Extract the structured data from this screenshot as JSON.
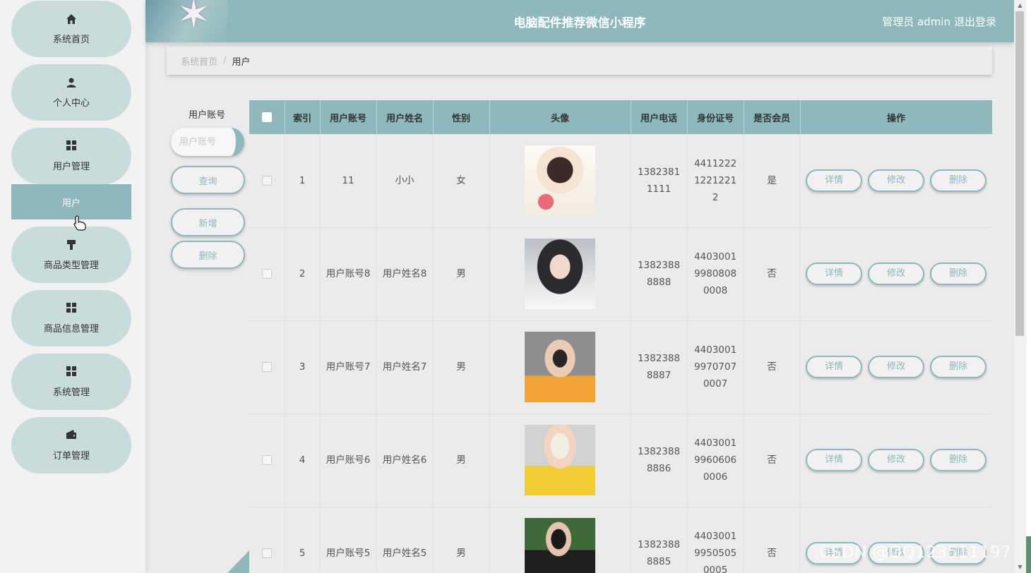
{
  "sidebar": {
    "items": [
      {
        "label": "系统首页",
        "icon": "home-icon",
        "glyph": "⌂"
      },
      {
        "label": "个人中心",
        "icon": "person-icon",
        "glyph": "👤"
      },
      {
        "label": "用户管理",
        "icon": "grid-icon",
        "glyph": "▦"
      },
      {
        "label": "商品类型管理",
        "icon": "brush-icon",
        "glyph": "▀"
      },
      {
        "label": "商品信息管理",
        "icon": "grid-icon",
        "glyph": "▦"
      },
      {
        "label": "系统管理",
        "icon": "grid-icon",
        "glyph": "▦"
      },
      {
        "label": "订单管理",
        "icon": "wallet-icon",
        "glyph": "▬"
      }
    ],
    "active_sub": "用户"
  },
  "header": {
    "title": "电脑配件推荐微信小程序",
    "user": "管理员 admin",
    "logout": "退出登录"
  },
  "breadcrumb": {
    "home": "系统首页",
    "separator": "/",
    "current": "用户"
  },
  "search": {
    "label": "用户账号",
    "placeholder": "用户账号",
    "query_button": "查询",
    "add_button": "新增",
    "delete_button": "删除"
  },
  "table": {
    "columns": [
      "索引",
      "用户账号",
      "用户姓名",
      "性别",
      "头像",
      "用户电话",
      "身份证号",
      "是否会员",
      "操作"
    ],
    "rows": [
      {
        "index": "1",
        "account": "11",
        "name": "小小",
        "gender": "女",
        "phone": "13823811111",
        "id_no": "441122212212212",
        "member": "是"
      },
      {
        "index": "2",
        "account": "用户账号8",
        "name": "用户姓名8",
        "gender": "男",
        "phone": "13823888888",
        "id_no": "440300199808080008",
        "member": "否"
      },
      {
        "index": "3",
        "account": "用户账号7",
        "name": "用户姓名7",
        "gender": "男",
        "phone": "13823888887",
        "id_no": "440300199707070007",
        "member": "否"
      },
      {
        "index": "4",
        "account": "用户账号6",
        "name": "用户姓名6",
        "gender": "男",
        "phone": "13823888886",
        "id_no": "440300199606060006",
        "member": "否"
      },
      {
        "index": "5",
        "account": "用户账号5",
        "name": "用户姓名5",
        "gender": "男",
        "phone": "13823888885",
        "id_no": "440300199505050005",
        "member": "否"
      }
    ],
    "actions": {
      "detail": "详情",
      "edit": "修改",
      "delete": "删除"
    }
  },
  "watermark": "CSDN @QQ123511197",
  "colors": {
    "accent": "#8eb8bb",
    "nav_pill": "#c9dcdc",
    "background": "#ebebeb"
  }
}
